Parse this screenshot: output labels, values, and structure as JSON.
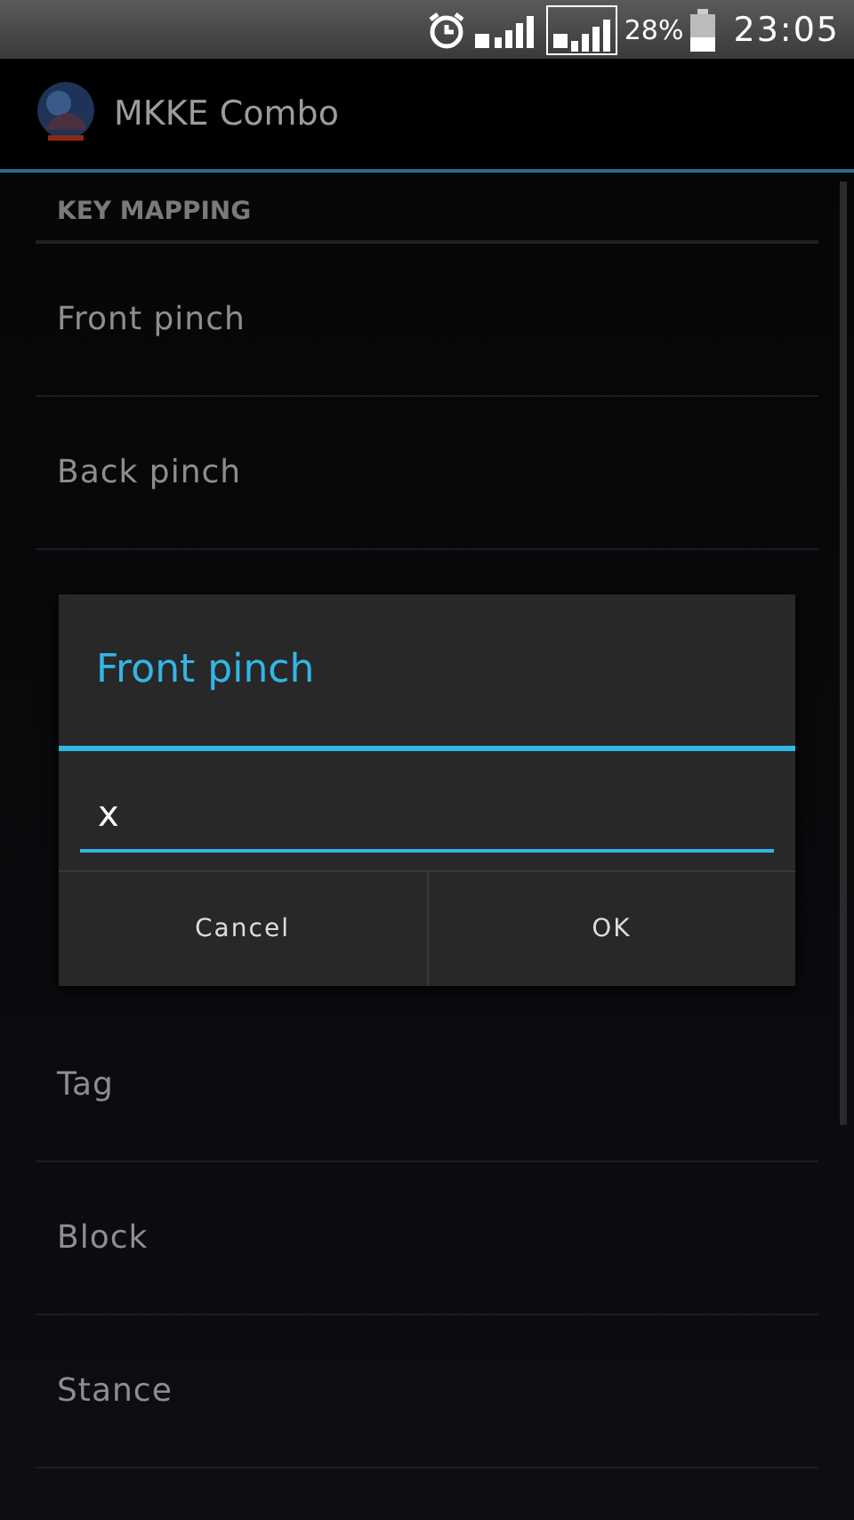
{
  "status_bar": {
    "battery_percent": "28%",
    "time": "23:05"
  },
  "app_bar": {
    "title": "MKKE Combo"
  },
  "section": {
    "title": "KEY MAPPING"
  },
  "items_above": [
    "Front pinch",
    "Back pinch"
  ],
  "items_below": [
    "Tag",
    "Block",
    "Stance"
  ],
  "dialog": {
    "title": "Front pinch",
    "input": {
      "value": "x"
    },
    "buttons": [
      "Cancel",
      "OK"
    ]
  }
}
